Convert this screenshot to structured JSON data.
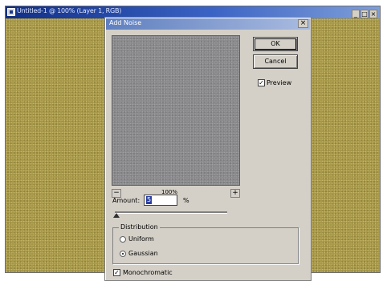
{
  "document_window": {
    "title": "Untitled-1 @ 100% (Layer 1, RGB)",
    "minimize": "_",
    "maximize": "□",
    "close": "×"
  },
  "dialog": {
    "title": "Add Noise",
    "close": "×",
    "ok_label": "OK",
    "cancel_label": "Cancel",
    "preview_label": "Preview",
    "preview_checked": true,
    "preview_checkmark": "✓",
    "zoom_out": "−",
    "zoom_in": "+",
    "zoom_level": "100%",
    "amount_label": "Amount:",
    "amount_value": "5",
    "amount_unit": "%",
    "amount_slider_value": 5,
    "distribution": {
      "legend": "Distribution",
      "options": [
        {
          "label": "Uniform",
          "selected": false
        },
        {
          "label": "Gaussian",
          "selected": true
        }
      ]
    },
    "monochromatic_label": "Monochromatic",
    "monochromatic_checked": true,
    "monochromatic_checkmark": "✓"
  },
  "colors": {
    "canvas_fill": "#a69748",
    "preview_fill": "#8a8a8c",
    "dialog_face": "#d4d0c8",
    "titlebar_active": "#102e86"
  }
}
